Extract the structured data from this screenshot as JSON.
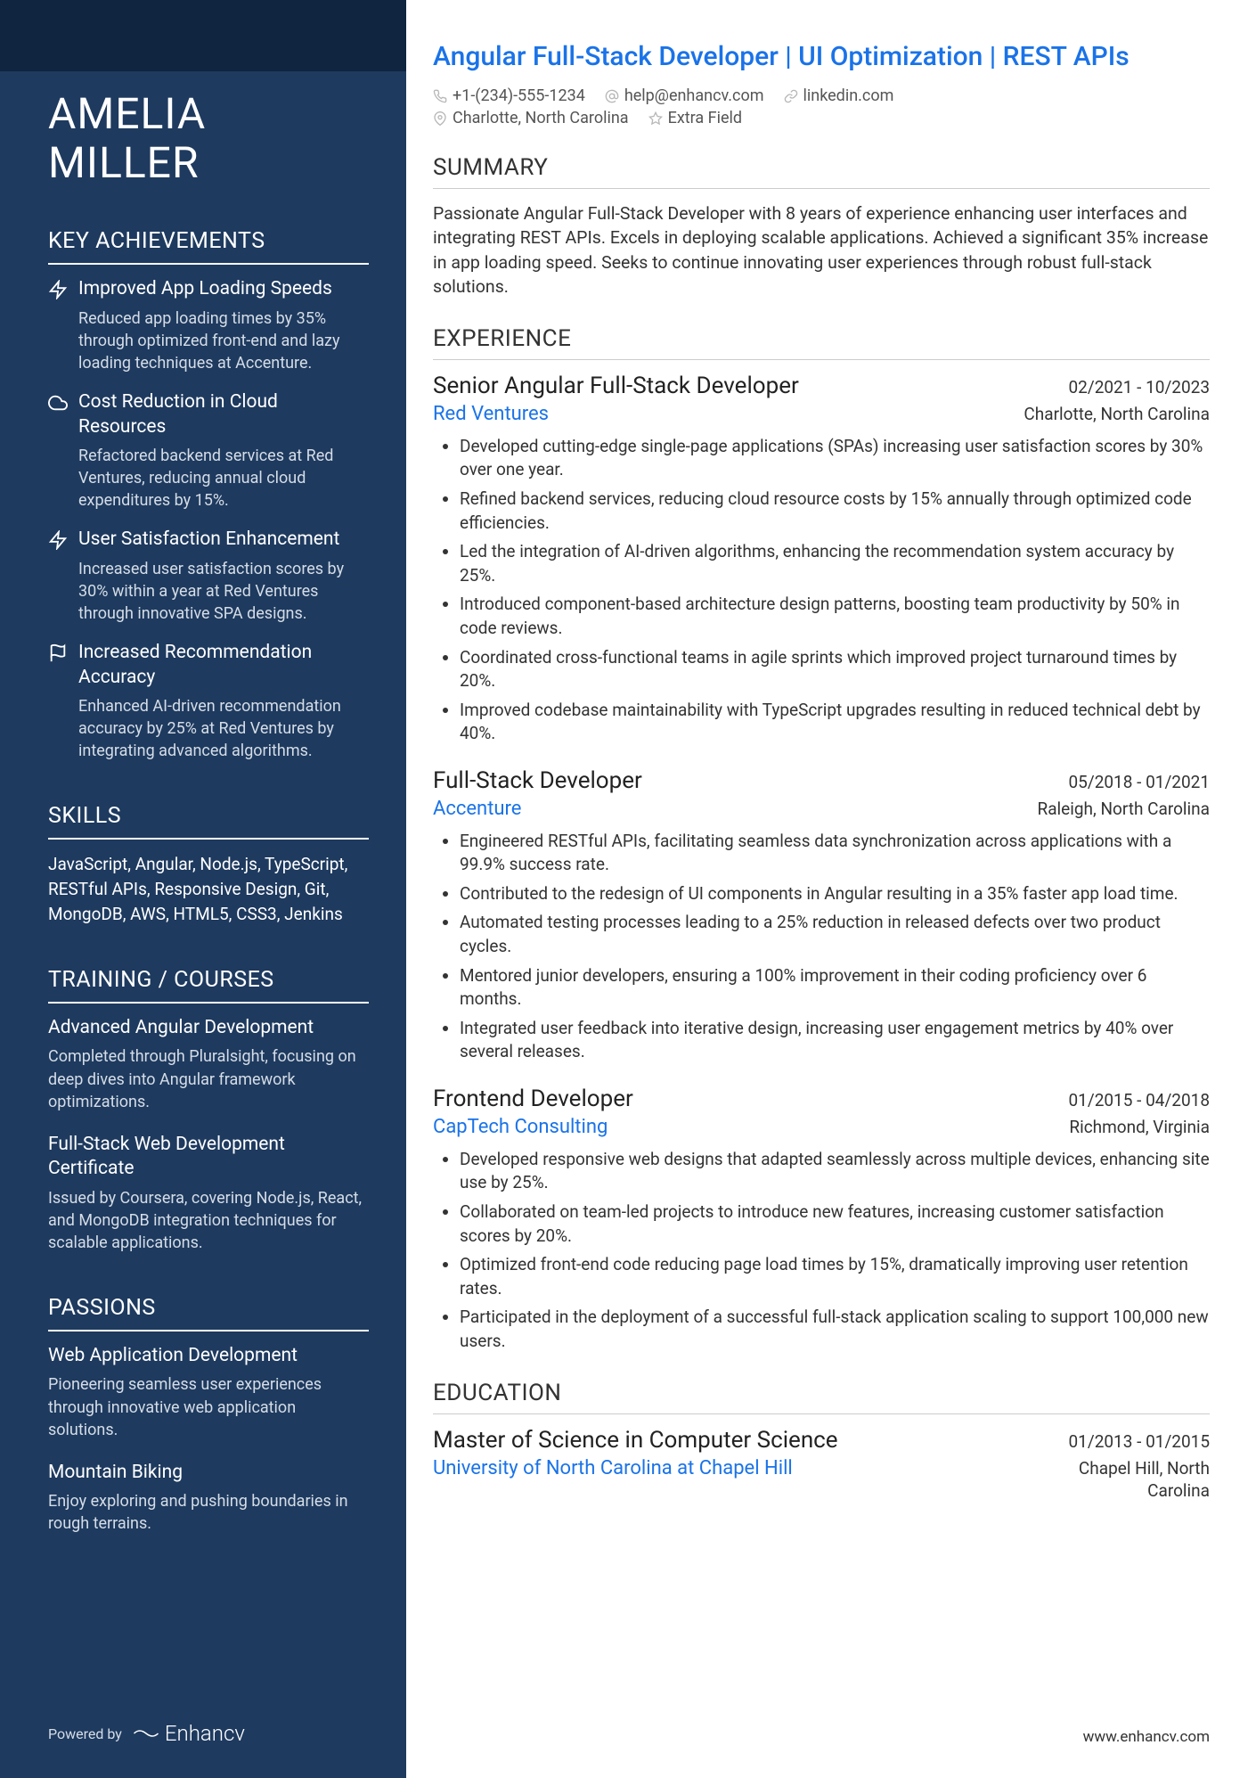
{
  "name_first": "AMELIA",
  "name_last": "MILLER",
  "tagline": "Angular Full-Stack Developer | UI Optimization | REST APIs",
  "contact": {
    "phone": "+1-(234)-555-1234",
    "email": "help@enhancv.com",
    "linkedin": "linkedin.com",
    "location": "Charlotte, North Carolina",
    "extra": "Extra Field"
  },
  "sidebar": {
    "achievements_heading": "KEY ACHIEVEMENTS",
    "achievements": [
      {
        "icon": "zap-icon",
        "title": "Improved App Loading Speeds",
        "desc": "Reduced app loading times by 35% through optimized front-end and lazy loading techniques at Accenture."
      },
      {
        "icon": "cloud-icon",
        "title": "Cost Reduction in Cloud Resources",
        "desc": "Refactored backend services at Red Ventures, reducing annual cloud expenditures by 15%."
      },
      {
        "icon": "zap-icon",
        "title": "User Satisfaction Enhancement",
        "desc": "Increased user satisfaction scores by 30% within a year at Red Ventures through innovative SPA designs."
      },
      {
        "icon": "flag-icon",
        "title": "Increased Recommendation Accuracy",
        "desc": "Enhanced AI-driven recommendation accuracy by 25% at Red Ventures by integrating advanced algorithms."
      }
    ],
    "skills_heading": "SKILLS",
    "skills": "JavaScript, Angular, Node.js, TypeScript, RESTful APIs, Responsive Design, Git, MongoDB, AWS, HTML5, CSS3, Jenkins",
    "training_heading": "TRAINING / COURSES",
    "courses": [
      {
        "title": "Advanced Angular Development",
        "desc": "Completed through Pluralsight, focusing on deep dives into Angular framework optimizations."
      },
      {
        "title": "Full-Stack Web Development Certificate",
        "desc": "Issued by Coursera, covering Node.js, React, and MongoDB integration techniques for scalable applications."
      }
    ],
    "passions_heading": "PASSIONS",
    "passions": [
      {
        "title": "Web Application Development",
        "desc": "Pioneering seamless user experiences through innovative web application solutions."
      },
      {
        "title": "Mountain Biking",
        "desc": "Enjoy exploring and pushing boundaries in rough terrains."
      }
    ]
  },
  "main": {
    "summary_heading": "SUMMARY",
    "summary": "Passionate Angular Full-Stack Developer with 8 years of experience enhancing user interfaces and integrating REST APIs. Excels in deploying scalable applications. Achieved a significant 35% increase in app loading speed. Seeks to continue innovating user experiences through robust full-stack solutions.",
    "experience_heading": "EXPERIENCE",
    "jobs": [
      {
        "title": "Senior Angular Full-Stack Developer",
        "dates": "02/2021 - 10/2023",
        "company": "Red Ventures",
        "location": "Charlotte, North Carolina",
        "bullets": [
          "Developed cutting-edge single-page applications (SPAs) increasing user satisfaction scores by 30% over one year.",
          "Refined backend services, reducing cloud resource costs by 15% annually through optimized code efficiencies.",
          "Led the integration of AI-driven algorithms, enhancing the recommendation system accuracy by 25%.",
          "Introduced component-based architecture design patterns, boosting team productivity by 50% in code reviews.",
          "Coordinated cross-functional teams in agile sprints which improved project turnaround times by 20%.",
          "Improved codebase maintainability with TypeScript upgrades resulting in reduced technical debt by 40%."
        ]
      },
      {
        "title": "Full-Stack Developer",
        "dates": "05/2018 - 01/2021",
        "company": "Accenture",
        "location": "Raleigh, North Carolina",
        "bullets": [
          "Engineered RESTful APIs, facilitating seamless data synchronization across applications with a 99.9% success rate.",
          "Contributed to the redesign of UI components in Angular resulting in a 35% faster app load time.",
          "Automated testing processes leading to a 25% reduction in released defects over two product cycles.",
          "Mentored junior developers, ensuring a 100% improvement in their coding proficiency over 6 months.",
          "Integrated user feedback into iterative design, increasing user engagement metrics by 40% over several releases."
        ]
      },
      {
        "title": "Frontend Developer",
        "dates": "01/2015 - 04/2018",
        "company": "CapTech Consulting",
        "location": "Richmond, Virginia",
        "bullets": [
          "Developed responsive web designs that adapted seamlessly across multiple devices, enhancing site use by 25%.",
          "Collaborated on team-led projects to introduce new features, increasing customer satisfaction scores by 20%.",
          "Optimized front-end code reducing page load times by 15%, dramatically improving user retention rates.",
          "Participated in the deployment of a successful full-stack application scaling to support 100,000 new users."
        ]
      }
    ],
    "education_heading": "EDUCATION",
    "education": [
      {
        "title": "Master of Science in Computer Science",
        "dates": "01/2013 - 01/2015",
        "school": "University of North Carolina at Chapel Hill",
        "location": "Chapel Hill, North Carolina"
      }
    ]
  },
  "footer": {
    "powered": "Powered by",
    "brand": "Enhancv",
    "url": "www.enhancv.com"
  }
}
